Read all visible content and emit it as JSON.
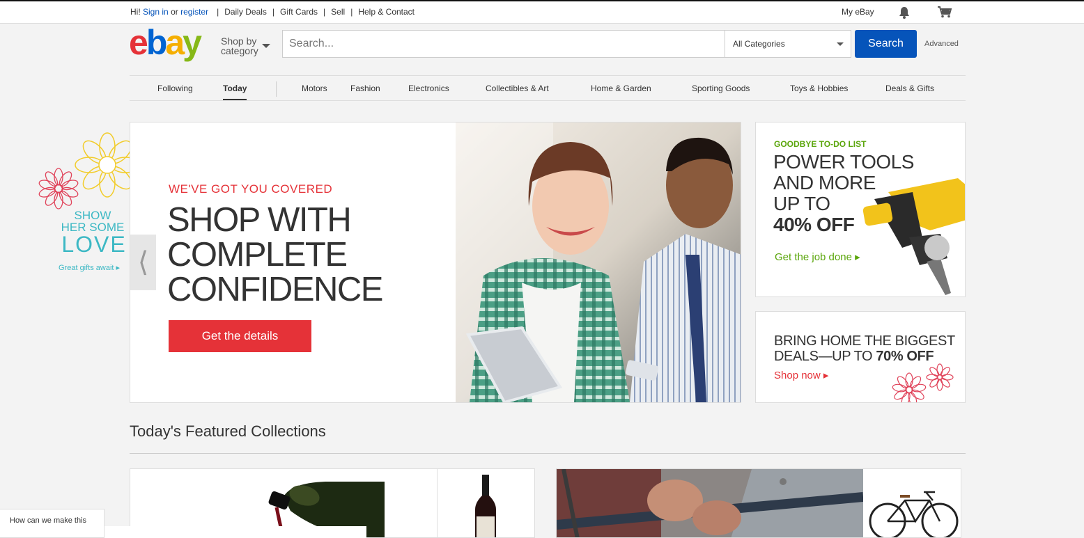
{
  "topbar": {
    "greeting": "Hi!",
    "sign_in": "Sign in",
    "or": "or",
    "register": "register",
    "links": [
      "Daily Deals",
      "Gift Cards",
      "Sell",
      "Help & Contact"
    ],
    "my_ebay": "My eBay"
  },
  "header": {
    "logo": {
      "e": "e",
      "b": "b",
      "a": "a",
      "y": "y"
    },
    "shop_by_line1": "Shop by",
    "shop_by_line2": "category",
    "search_placeholder": "Search...",
    "category_selected": "All Categories",
    "search_button": "Search",
    "advanced": "Advanced"
  },
  "nav": {
    "items": [
      {
        "label": "Following"
      },
      {
        "label": "Today"
      },
      {
        "label": "Motors"
      },
      {
        "label": "Fashion"
      },
      {
        "label": "Electronics"
      },
      {
        "label": "Collectibles & Art"
      },
      {
        "label": "Home & Garden"
      },
      {
        "label": "Sporting Goods"
      },
      {
        "label": "Toys & Hobbies"
      },
      {
        "label": "Deals & Gifts"
      }
    ]
  },
  "left_promo": {
    "line1": "SHOW",
    "line2": "HER SOME",
    "love": "LOVE",
    "cta": "Great gifts await ▸"
  },
  "hero": {
    "kicker": "WE'VE GOT YOU COVERED",
    "headline_line1": "SHOP WITH",
    "headline_line2": "COMPLETE",
    "headline_line3": "CONFIDENCE",
    "cta": "Get the details"
  },
  "promo_tools": {
    "kicker": "GOODBYE TO-DO LIST",
    "line1": "POWER TOOLS",
    "line2": "AND MORE",
    "line3": "UP TO",
    "line4": "40% OFF",
    "cta": "Get the job done ▸"
  },
  "promo_deals": {
    "line1": "BRING HOME THE BIGGEST",
    "line2a": "DEALS—UP TO ",
    "line2b": "70% OFF",
    "cta": "Shop now ▸"
  },
  "featured": {
    "title": "Today's Featured Collections"
  },
  "feedback": {
    "text": "How can we make this"
  },
  "colors": {
    "ebay_red": "#e53238",
    "ebay_blue": "#0654ba",
    "ebay_yellow": "#f5af02",
    "ebay_green": "#86b817",
    "teal": "#3cb8c4",
    "promo_green": "#5ba60c"
  }
}
